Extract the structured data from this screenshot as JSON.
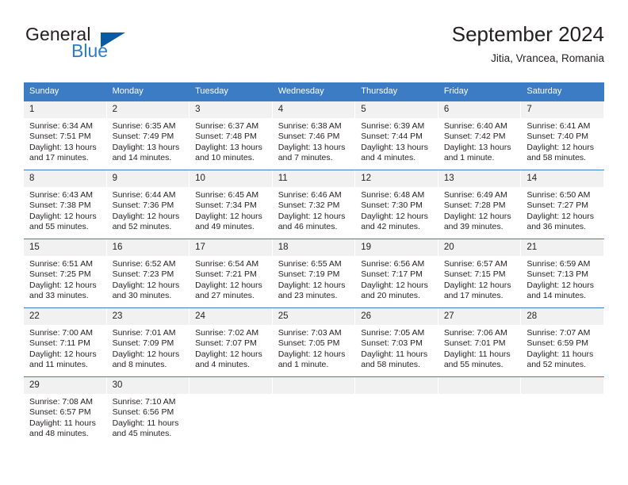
{
  "brand": {
    "name_part1": "General",
    "name_part2": "Blue",
    "logo_icon": "blue-triangle-icon"
  },
  "header": {
    "title": "September 2024",
    "subtitle": "Jitia, Vrancea, Romania"
  },
  "colors": {
    "header_blue": "#3b7cc4",
    "logo_blue": "#0a5ba3",
    "brand_blue_text": "#2a7dc9",
    "daynum_band": "#f1f1f1",
    "text": "#231f20"
  },
  "weekday_headers": [
    "Sunday",
    "Monday",
    "Tuesday",
    "Wednesday",
    "Thursday",
    "Friday",
    "Saturday"
  ],
  "weeks": [
    [
      {
        "day": "1",
        "sunrise": "Sunrise: 6:34 AM",
        "sunset": "Sunset: 7:51 PM",
        "daylight": "Daylight: 13 hours and 17 minutes."
      },
      {
        "day": "2",
        "sunrise": "Sunrise: 6:35 AM",
        "sunset": "Sunset: 7:49 PM",
        "daylight": "Daylight: 13 hours and 14 minutes."
      },
      {
        "day": "3",
        "sunrise": "Sunrise: 6:37 AM",
        "sunset": "Sunset: 7:48 PM",
        "daylight": "Daylight: 13 hours and 10 minutes."
      },
      {
        "day": "4",
        "sunrise": "Sunrise: 6:38 AM",
        "sunset": "Sunset: 7:46 PM",
        "daylight": "Daylight: 13 hours and 7 minutes."
      },
      {
        "day": "5",
        "sunrise": "Sunrise: 6:39 AM",
        "sunset": "Sunset: 7:44 PM",
        "daylight": "Daylight: 13 hours and 4 minutes."
      },
      {
        "day": "6",
        "sunrise": "Sunrise: 6:40 AM",
        "sunset": "Sunset: 7:42 PM",
        "daylight": "Daylight: 13 hours and 1 minute."
      },
      {
        "day": "7",
        "sunrise": "Sunrise: 6:41 AM",
        "sunset": "Sunset: 7:40 PM",
        "daylight": "Daylight: 12 hours and 58 minutes."
      }
    ],
    [
      {
        "day": "8",
        "sunrise": "Sunrise: 6:43 AM",
        "sunset": "Sunset: 7:38 PM",
        "daylight": "Daylight: 12 hours and 55 minutes."
      },
      {
        "day": "9",
        "sunrise": "Sunrise: 6:44 AM",
        "sunset": "Sunset: 7:36 PM",
        "daylight": "Daylight: 12 hours and 52 minutes."
      },
      {
        "day": "10",
        "sunrise": "Sunrise: 6:45 AM",
        "sunset": "Sunset: 7:34 PM",
        "daylight": "Daylight: 12 hours and 49 minutes."
      },
      {
        "day": "11",
        "sunrise": "Sunrise: 6:46 AM",
        "sunset": "Sunset: 7:32 PM",
        "daylight": "Daylight: 12 hours and 46 minutes."
      },
      {
        "day": "12",
        "sunrise": "Sunrise: 6:48 AM",
        "sunset": "Sunset: 7:30 PM",
        "daylight": "Daylight: 12 hours and 42 minutes."
      },
      {
        "day": "13",
        "sunrise": "Sunrise: 6:49 AM",
        "sunset": "Sunset: 7:28 PM",
        "daylight": "Daylight: 12 hours and 39 minutes."
      },
      {
        "day": "14",
        "sunrise": "Sunrise: 6:50 AM",
        "sunset": "Sunset: 7:27 PM",
        "daylight": "Daylight: 12 hours and 36 minutes."
      }
    ],
    [
      {
        "day": "15",
        "sunrise": "Sunrise: 6:51 AM",
        "sunset": "Sunset: 7:25 PM",
        "daylight": "Daylight: 12 hours and 33 minutes."
      },
      {
        "day": "16",
        "sunrise": "Sunrise: 6:52 AM",
        "sunset": "Sunset: 7:23 PM",
        "daylight": "Daylight: 12 hours and 30 minutes."
      },
      {
        "day": "17",
        "sunrise": "Sunrise: 6:54 AM",
        "sunset": "Sunset: 7:21 PM",
        "daylight": "Daylight: 12 hours and 27 minutes."
      },
      {
        "day": "18",
        "sunrise": "Sunrise: 6:55 AM",
        "sunset": "Sunset: 7:19 PM",
        "daylight": "Daylight: 12 hours and 23 minutes."
      },
      {
        "day": "19",
        "sunrise": "Sunrise: 6:56 AM",
        "sunset": "Sunset: 7:17 PM",
        "daylight": "Daylight: 12 hours and 20 minutes."
      },
      {
        "day": "20",
        "sunrise": "Sunrise: 6:57 AM",
        "sunset": "Sunset: 7:15 PM",
        "daylight": "Daylight: 12 hours and 17 minutes."
      },
      {
        "day": "21",
        "sunrise": "Sunrise: 6:59 AM",
        "sunset": "Sunset: 7:13 PM",
        "daylight": "Daylight: 12 hours and 14 minutes."
      }
    ],
    [
      {
        "day": "22",
        "sunrise": "Sunrise: 7:00 AM",
        "sunset": "Sunset: 7:11 PM",
        "daylight": "Daylight: 12 hours and 11 minutes."
      },
      {
        "day": "23",
        "sunrise": "Sunrise: 7:01 AM",
        "sunset": "Sunset: 7:09 PM",
        "daylight": "Daylight: 12 hours and 8 minutes."
      },
      {
        "day": "24",
        "sunrise": "Sunrise: 7:02 AM",
        "sunset": "Sunset: 7:07 PM",
        "daylight": "Daylight: 12 hours and 4 minutes."
      },
      {
        "day": "25",
        "sunrise": "Sunrise: 7:03 AM",
        "sunset": "Sunset: 7:05 PM",
        "daylight": "Daylight: 12 hours and 1 minute."
      },
      {
        "day": "26",
        "sunrise": "Sunrise: 7:05 AM",
        "sunset": "Sunset: 7:03 PM",
        "daylight": "Daylight: 11 hours and 58 minutes."
      },
      {
        "day": "27",
        "sunrise": "Sunrise: 7:06 AM",
        "sunset": "Sunset: 7:01 PM",
        "daylight": "Daylight: 11 hours and 55 minutes."
      },
      {
        "day": "28",
        "sunrise": "Sunrise: 7:07 AM",
        "sunset": "Sunset: 6:59 PM",
        "daylight": "Daylight: 11 hours and 52 minutes."
      }
    ],
    [
      {
        "day": "29",
        "sunrise": "Sunrise: 7:08 AM",
        "sunset": "Sunset: 6:57 PM",
        "daylight": "Daylight: 11 hours and 48 minutes."
      },
      {
        "day": "30",
        "sunrise": "Sunrise: 7:10 AM",
        "sunset": "Sunset: 6:56 PM",
        "daylight": "Daylight: 11 hours and 45 minutes."
      },
      {
        "day": "",
        "sunrise": "",
        "sunset": "",
        "daylight": ""
      },
      {
        "day": "",
        "sunrise": "",
        "sunset": "",
        "daylight": ""
      },
      {
        "day": "",
        "sunrise": "",
        "sunset": "",
        "daylight": ""
      },
      {
        "day": "",
        "sunrise": "",
        "sunset": "",
        "daylight": ""
      },
      {
        "day": "",
        "sunrise": "",
        "sunset": "",
        "daylight": ""
      }
    ]
  ]
}
